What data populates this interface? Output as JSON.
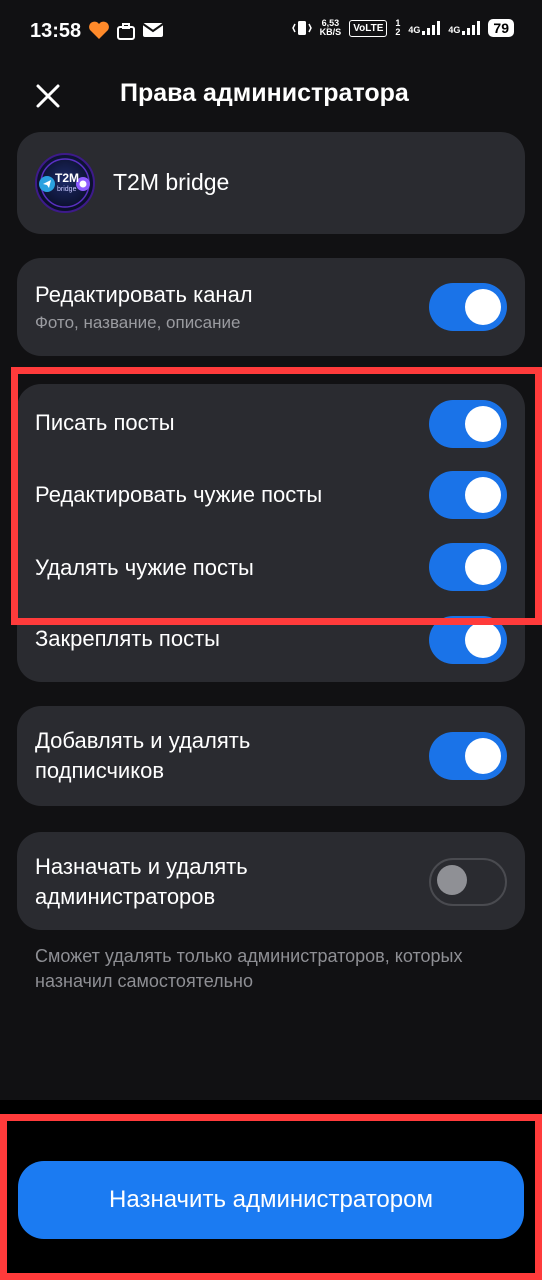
{
  "status": {
    "time": "13:58",
    "net_speed_top": "6,53",
    "net_speed_bottom": "KB/S",
    "volte": "VoLTE",
    "sim1": "1",
    "sim2": "2",
    "net1": "4G",
    "net2": "4G",
    "battery": "79"
  },
  "header": {
    "title": "Права администратора"
  },
  "channel": {
    "name": "T2M bridge",
    "avatar_text": "T2M",
    "avatar_subtext": "bridge"
  },
  "permissions": [
    {
      "title": "Редактировать канал",
      "subtitle": "Фото, название, описание",
      "enabled": true
    },
    {
      "title": "Писать посты",
      "enabled": true
    },
    {
      "title": "Редактировать чужие посты",
      "enabled": true
    },
    {
      "title": "Удалять чужие посты",
      "enabled": true
    },
    {
      "title": "Закреплять посты",
      "enabled": true
    },
    {
      "title": "Добавлять и удалять подписчиков",
      "enabled": true
    },
    {
      "title": "Назначать и удалять администраторов",
      "enabled": false
    }
  ],
  "note": "Сможет удалять только администраторов, которых назначил самостоятельно",
  "primary_button": "Назначить администратором",
  "colors": {
    "accent": "#1b7bf2",
    "highlight": "#ff3b3b",
    "card": "#2a2b30",
    "background": "#111113"
  }
}
